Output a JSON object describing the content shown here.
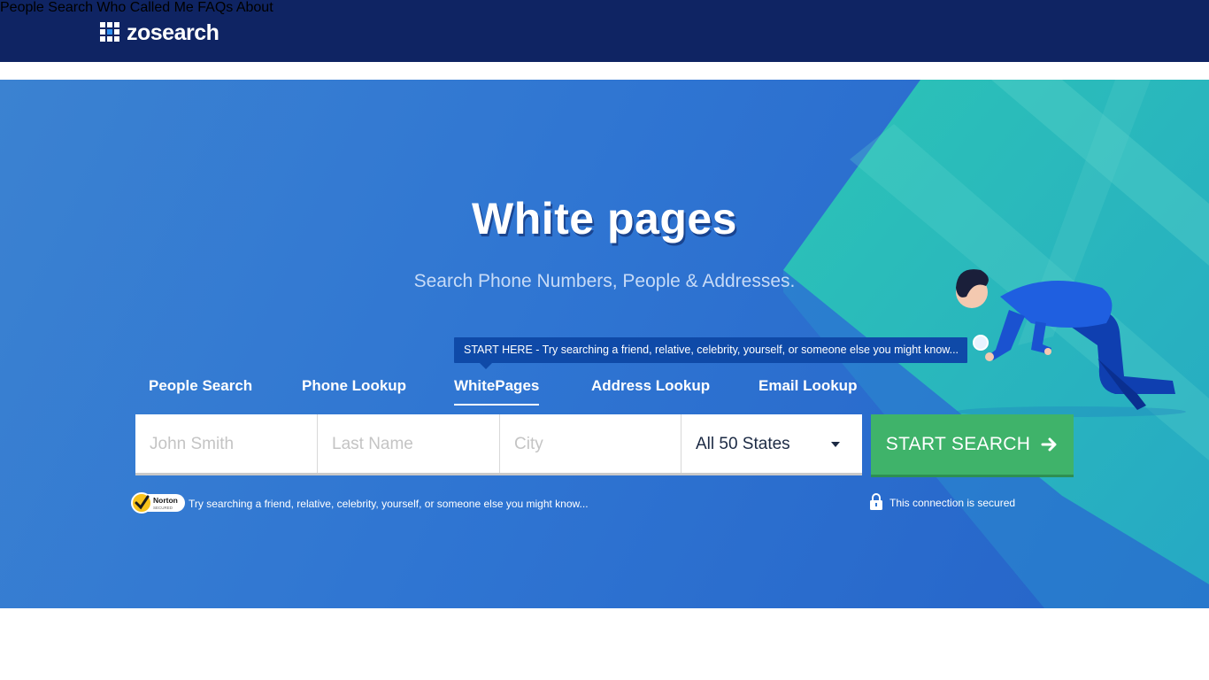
{
  "header": {
    "logo_text": "zosearch",
    "nav": [
      {
        "label": "People Search"
      },
      {
        "label": "Who Called Me"
      },
      {
        "label": "FAQs"
      },
      {
        "label": "About"
      }
    ]
  },
  "hero": {
    "title": "White pages",
    "subtitle": "Search Phone Numbers, People & Addresses.",
    "tooltip": "START HERE - Try searching a friend, relative, celebrity, yourself, or someone else you might know...",
    "tabs": [
      {
        "label": "People Search"
      },
      {
        "label": "Phone Lookup"
      },
      {
        "label": "WhitePages",
        "active": true
      },
      {
        "label": "Address Lookup"
      },
      {
        "label": "Email Lookup"
      }
    ],
    "search": {
      "first_name_placeholder": "John Smith",
      "last_name_placeholder": "Last Name",
      "city_placeholder": "City",
      "state_selected": "All 50 States",
      "button_label": "START SEARCH"
    },
    "norton_badge": {
      "line1": "Norton",
      "line2": "SECURED"
    },
    "secure_note": "Try searching a friend, relative, celebrity, yourself, or someone else you might know...",
    "connection_note": "This connection is secured"
  },
  "colors": {
    "header_bg": "#0f2463",
    "hero_blue": "#2f75d2",
    "accent_teal": "#2bbfb5",
    "button_green": "#3fb36a",
    "tooltip_bg": "#0f4aa8"
  },
  "icons": [
    "logo-grid-icon",
    "dropdown-caret-icon",
    "arrow-right-icon",
    "norton-check-icon",
    "lock-icon"
  ]
}
